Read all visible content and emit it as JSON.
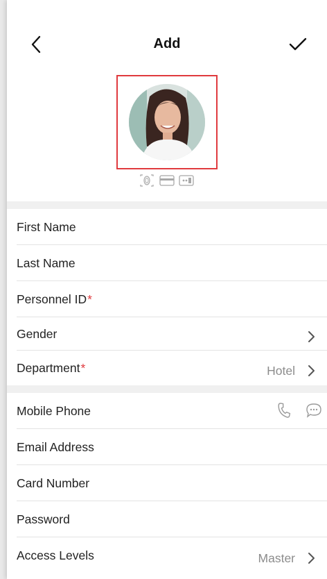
{
  "header": {
    "title": "Add",
    "back_icon": "chevron-left-icon",
    "done_icon": "checkmark-icon"
  },
  "photo": {
    "avatar_icon": "user-photo",
    "credential_icons": [
      "fingerprint-icon",
      "card-icon",
      "card-reader-icon"
    ],
    "highlight_color": "#e03a3e"
  },
  "basic_fields": [
    {
      "label": "First Name",
      "required": false
    },
    {
      "label": "Last Name",
      "required": false
    },
    {
      "label": "Personnel ID",
      "required": true
    },
    {
      "label": "Gender",
      "required": false
    },
    {
      "label": "Department",
      "required": true,
      "value": "Hotel"
    }
  ],
  "contact_fields": [
    {
      "label": "Mobile Phone"
    },
    {
      "label": "Email Address"
    },
    {
      "label": "Card Number"
    },
    {
      "label": "Password"
    },
    {
      "label": "Access Levels",
      "value": "Master"
    }
  ],
  "required_marker": "*",
  "colors": {
    "required": "#e03a3e",
    "value_text": "#8c8c8c",
    "separator": "#f0f0f0"
  }
}
